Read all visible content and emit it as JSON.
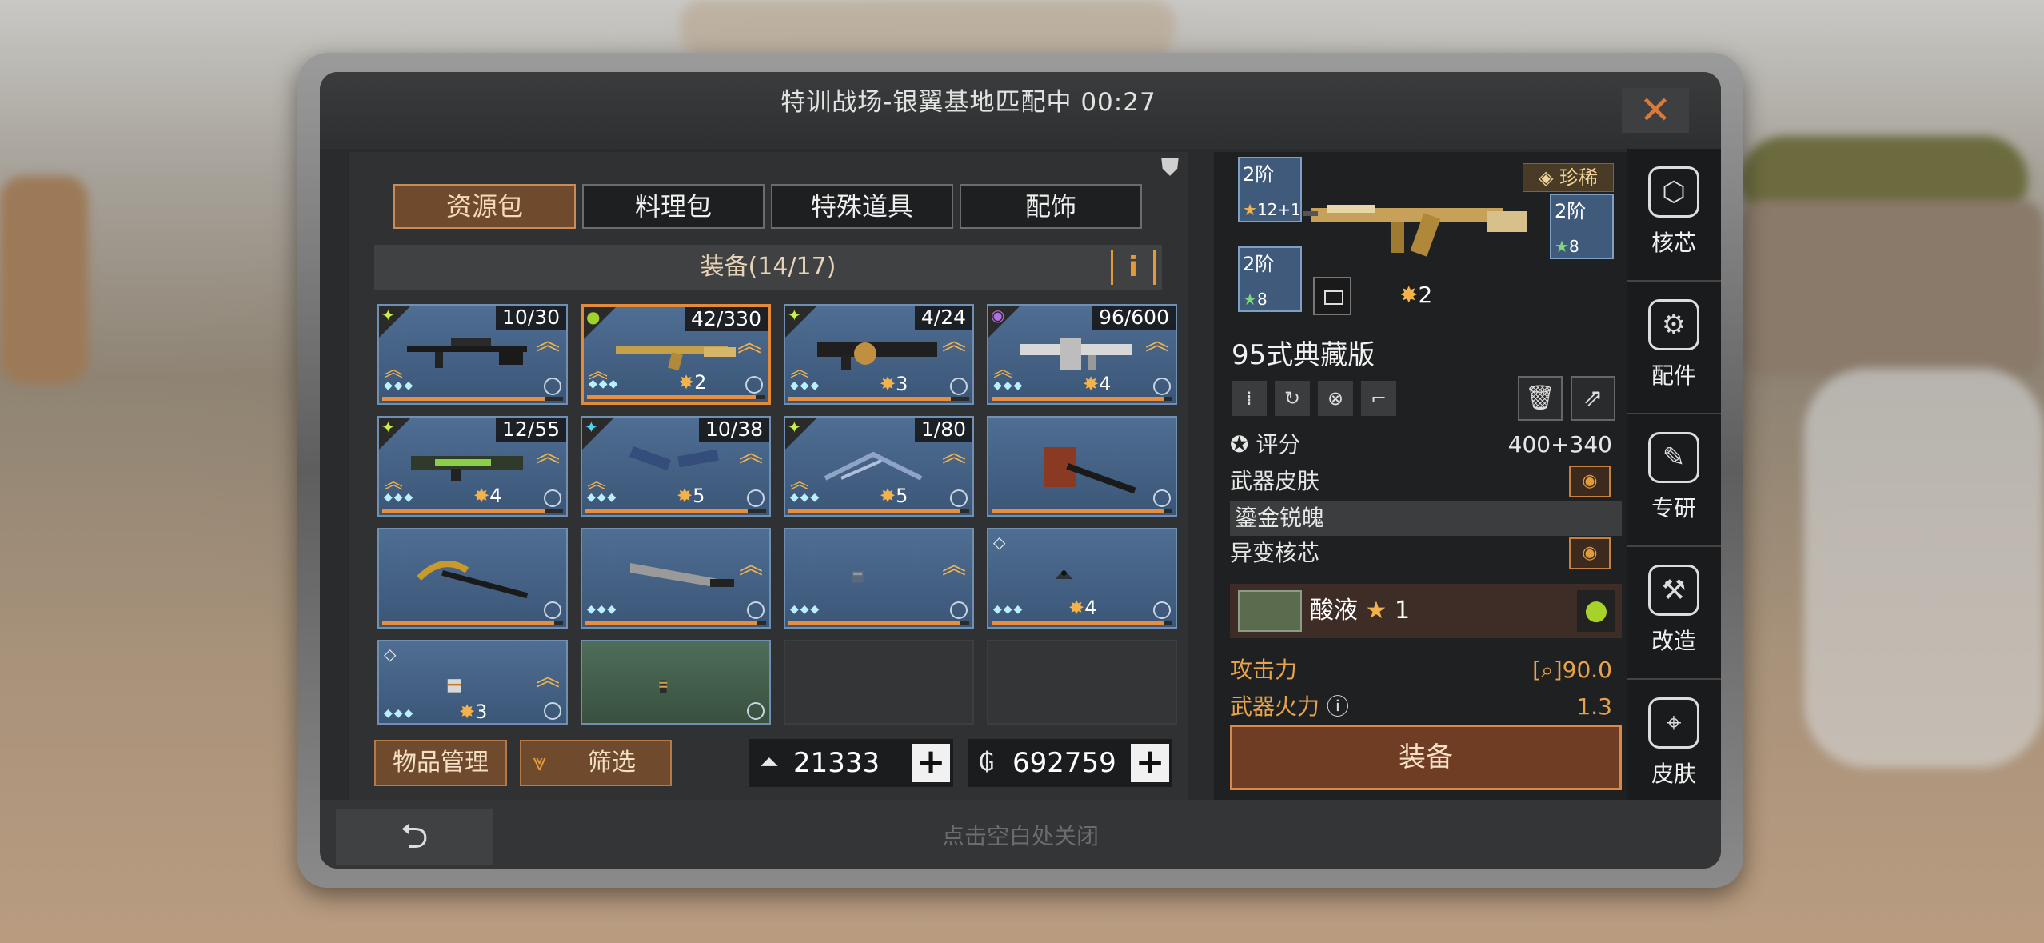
{
  "window": {
    "title": "特训战场-银翼基地匹配中 00:27",
    "close_icon": "✕"
  },
  "tabs": [
    {
      "label": "资源包",
      "active": true
    },
    {
      "label": "料理包",
      "active": false
    },
    {
      "label": "特殊道具",
      "active": false
    },
    {
      "label": "配饰",
      "active": false
    }
  ],
  "inventory": {
    "header": "装备(14/17)",
    "info_label": "i",
    "items": [
      {
        "count": "10/30",
        "rarity_icon": "wing",
        "level": "",
        "upgradable": true,
        "progress": 0.9
      },
      {
        "count": "42/330",
        "rarity_icon": "drop",
        "level": "2",
        "upgradable": true,
        "selected": true,
        "progress": 0.95
      },
      {
        "count": "4/24",
        "rarity_icon": "wing",
        "level": "3",
        "upgradable": true,
        "progress": 0.9
      },
      {
        "count": "96/600",
        "rarity_icon": "orb",
        "level": "4",
        "upgradable": true,
        "progress": 0.95
      },
      {
        "count": "12/55",
        "rarity_icon": "wing",
        "level": "4",
        "upgradable": true,
        "progress": 0.9
      },
      {
        "count": "10/38",
        "rarity_icon": "wing",
        "level": "5",
        "upgradable": true,
        "progress": 0.9
      },
      {
        "count": "1/80",
        "rarity_icon": "wing",
        "level": "5",
        "upgradable": true,
        "progress": 0.95
      },
      {
        "count": "",
        "rarity_icon": "",
        "level": "",
        "upgradable": false,
        "progress": 0.95
      },
      {
        "count": "",
        "rarity_icon": "",
        "level": "",
        "upgradable": false,
        "progress": 0.95
      },
      {
        "count": "",
        "rarity_icon": "",
        "level": "",
        "upgradable": true,
        "progress": 0.95
      },
      {
        "count": "",
        "rarity_icon": "",
        "level": "",
        "upgradable": true,
        "progress": 0.95
      },
      {
        "count": "",
        "rarity_icon": "diamond",
        "level": "4",
        "upgradable": false,
        "progress": 0.95
      },
      {
        "count": "",
        "rarity_icon": "diamond",
        "level": "3",
        "upgradable": true,
        "progress": 0.95
      },
      {
        "count": "",
        "rarity_icon": "",
        "level": "",
        "upgradable": false,
        "progress": 0
      }
    ],
    "manage_label": "物品管理",
    "filter_label": "筛选",
    "currency_a": "21333",
    "currency_b": "692759",
    "plus_label": "+"
  },
  "detail": {
    "rarity": "珍稀",
    "slot1": {
      "tier": "2阶",
      "level": "12+1"
    },
    "slot2": {
      "tier": "2阶",
      "level": "8"
    },
    "slot3": {
      "tier": "2阶",
      "level": "8"
    },
    "gun_level": "2",
    "name": "95式典藏版",
    "score_label": "评分",
    "score_value": "400+340",
    "skin_label": "武器皮肤",
    "skin_name": "鎏金锐魄",
    "mutation_label": "异变核芯",
    "core_name": "酸液",
    "core_level": "1",
    "attack_label": "攻击力",
    "attack_value": "90.0",
    "firepower_label": "武器火力",
    "firepower_value": "1.3",
    "equip_label": "装备"
  },
  "side_nav": [
    {
      "label": "核芯",
      "icon": "core-icon"
    },
    {
      "label": "配件",
      "icon": "attachment-icon"
    },
    {
      "label": "专研",
      "icon": "research-icon"
    },
    {
      "label": "改造",
      "icon": "modify-icon"
    },
    {
      "label": "皮肤",
      "icon": "skin-icon"
    }
  ],
  "bottom": {
    "close_hint": "点击空白处关闭",
    "back_icon": "⮌"
  }
}
